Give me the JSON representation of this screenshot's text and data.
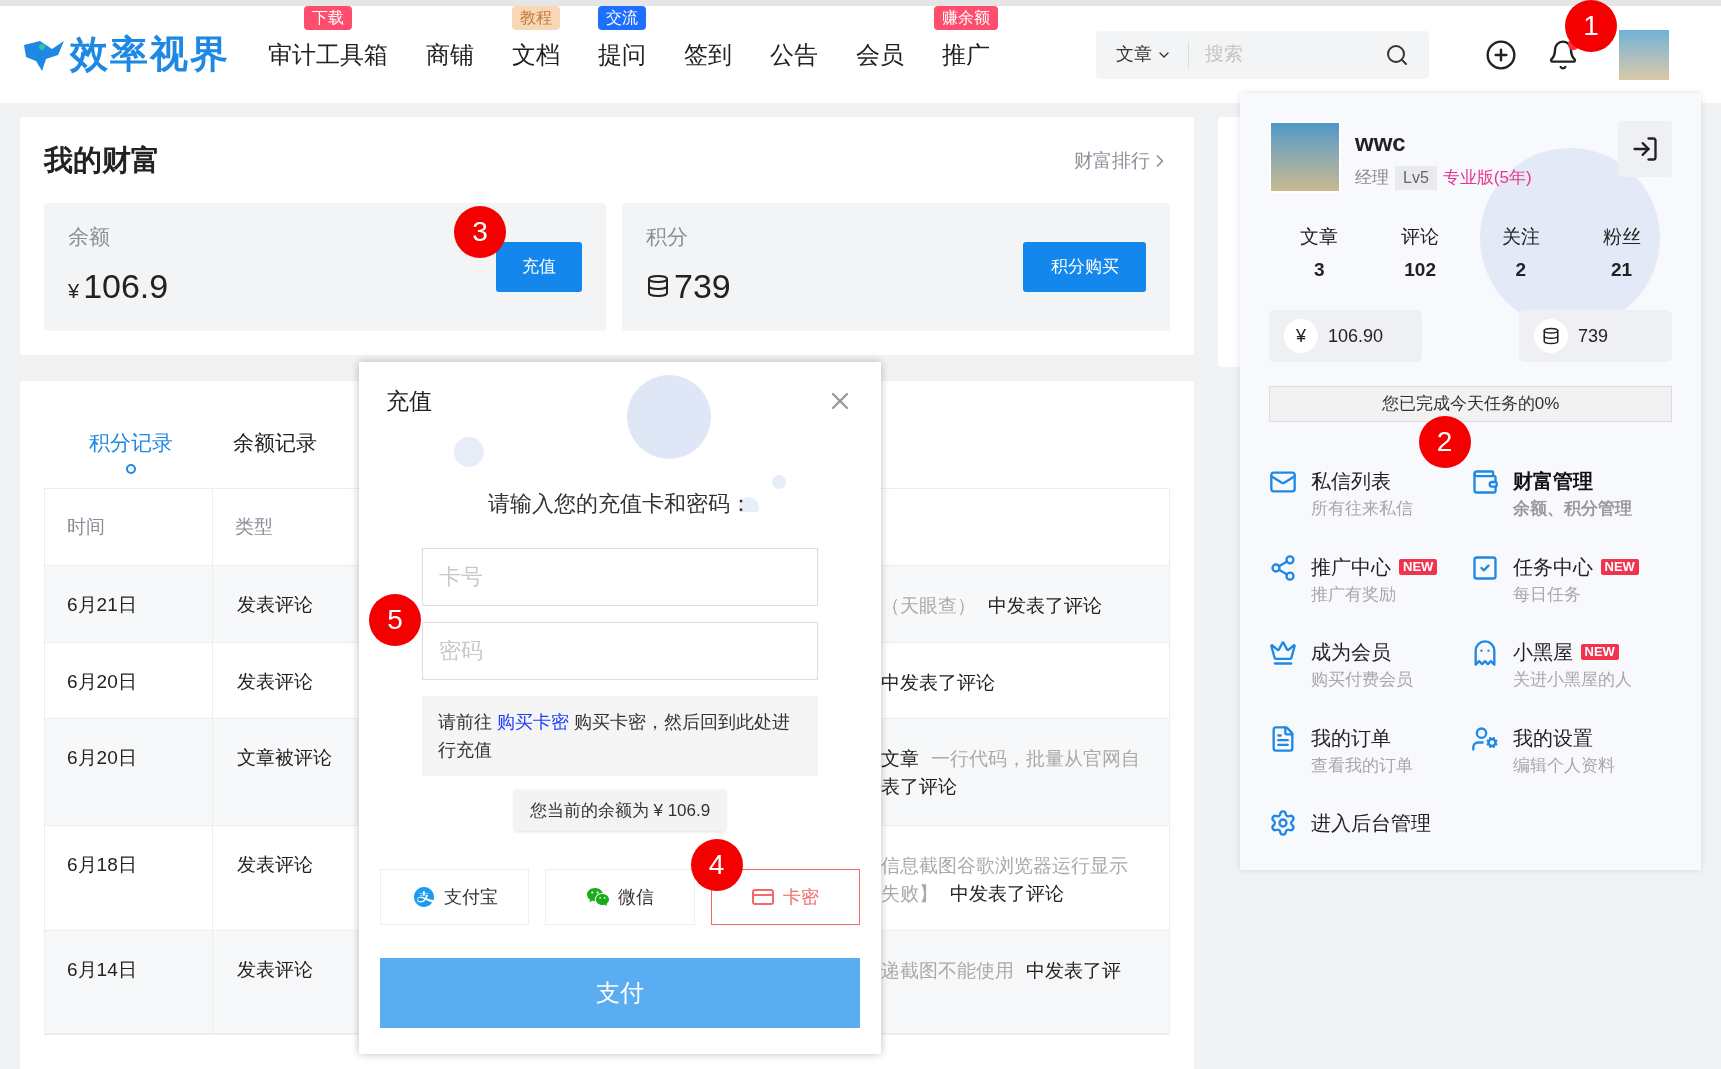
{
  "header": {
    "logo": "效率视界",
    "nav": [
      {
        "label": "审计工具箱",
        "badge": {
          "text": "下载",
          "color": "#ff4d6d"
        }
      },
      {
        "label": "商铺"
      },
      {
        "label": "文档",
        "badge": {
          "text": "教程",
          "color": "#f7d7b5"
        }
      },
      {
        "label": "提问",
        "badge": {
          "text": "交流",
          "color": "#1e6fff"
        }
      },
      {
        "label": "签到"
      },
      {
        "label": "公告"
      },
      {
        "label": "会员"
      },
      {
        "label": "推广",
        "badge": {
          "text": "赚余额",
          "color": "#ff4d6d"
        }
      }
    ],
    "search": {
      "scope": "文章",
      "placeholder": "搜索"
    },
    "notification_dot": true,
    "marker": "1"
  },
  "wealth": {
    "title": "我的财富",
    "ranking_link": "财富排行",
    "balance": {
      "label": "余额",
      "currency": "¥",
      "value": "106.9",
      "button": "充值",
      "marker": "3"
    },
    "points": {
      "label": "积分",
      "value": "739",
      "button": "积分购买"
    }
  },
  "records": {
    "tabs": [
      {
        "label": "积分记录",
        "selected": true
      },
      {
        "label": "余额记录",
        "selected": false
      }
    ],
    "columns": [
      "时间",
      "类型"
    ],
    "rows": [
      {
        "time": "6月21日",
        "type": "发表评论",
        "detail": [
          [
            {
              "text": "（天眼查）",
              "kind": "muted"
            },
            {
              "text": "中发表了评论",
              "kind": "plain"
            }
          ]
        ]
      },
      {
        "time": "6月20日",
        "type": "发表评论",
        "detail": [
          [
            {
              "text": "中发表了评论",
              "kind": "plain"
            }
          ]
        ]
      },
      {
        "time": "6月20日",
        "type": "文章被评论",
        "detail": [
          [
            {
              "text": "文章",
              "kind": "plain"
            },
            {
              "text": "一行代码，批量从官网自",
              "kind": "muted"
            }
          ],
          [
            {
              "text": "表了评论",
              "kind": "plain"
            }
          ]
        ]
      },
      {
        "time": "6月18日",
        "type": "发表评论",
        "detail": [
          [
            {
              "text": "信息截图谷歌浏览器运行显示",
              "kind": "muted"
            }
          ],
          [
            {
              "text": "失败】",
              "kind": "muted"
            },
            {
              "text": "中发表了评论",
              "kind": "plain"
            }
          ]
        ]
      },
      {
        "time": "6月14日",
        "type": "发表评论",
        "detail": [
          [
            {
              "text": "递截图不能使用",
              "kind": "muted"
            },
            {
              "text": "中发表了评",
              "kind": "plain"
            }
          ]
        ]
      }
    ]
  },
  "recharge_dialog": {
    "title": "充值",
    "prompt": "请输入您的充值卡和密码：",
    "fields": [
      {
        "placeholder": "卡号"
      },
      {
        "placeholder": "密码"
      }
    ],
    "fields_marker": "5",
    "notice": {
      "before": "请前往",
      "link": "购买卡密",
      "after": "购买卡密，然后回到此处进行充值"
    },
    "current_balance": "您当前的余额为 ¥ 106.9",
    "payment_methods": [
      {
        "label": "支付宝",
        "selected": false
      },
      {
        "label": "微信",
        "selected": false
      },
      {
        "label": "卡密",
        "selected": true
      }
    ],
    "methods_marker": "4",
    "pay_button": "支付"
  },
  "user_menu": {
    "name": "wwc",
    "role": "经理",
    "level": "Lv5",
    "plan": "专业版(5年)",
    "stats": [
      {
        "label": "文章",
        "value": "3"
      },
      {
        "label": "评论",
        "value": "102"
      },
      {
        "label": "关注",
        "value": "2"
      },
      {
        "label": "粉丝",
        "value": "21"
      }
    ],
    "wallet": {
      "currency": "¥",
      "balance": "106.90",
      "points": "739"
    },
    "task_progress": {
      "text": "您已完成今天任务的0%",
      "level": 0
    },
    "items": [
      {
        "title": "私信列表",
        "subtitle": "所有往来私信",
        "selected": false
      },
      {
        "title": "财富管理",
        "subtitle": "余额、积分管理",
        "selected": true,
        "marker": "2"
      },
      {
        "title": "推广中心",
        "subtitle": "推广有奖励",
        "selected": false,
        "badge": "NEW"
      },
      {
        "title": "任务中心",
        "subtitle": "每日任务",
        "selected": false,
        "badge": "NEW"
      },
      {
        "title": "成为会员",
        "subtitle": "购买付费会员",
        "selected": false
      },
      {
        "title": "小黑屋",
        "subtitle": "关进小黑屋的人",
        "selected": false,
        "badge": "NEW"
      },
      {
        "title": "我的订单",
        "subtitle": "查看我的订单",
        "selected": false
      },
      {
        "title": "我的设置",
        "subtitle": "编辑个人资料",
        "selected": false
      }
    ],
    "admin_link": "进入后台管理"
  }
}
